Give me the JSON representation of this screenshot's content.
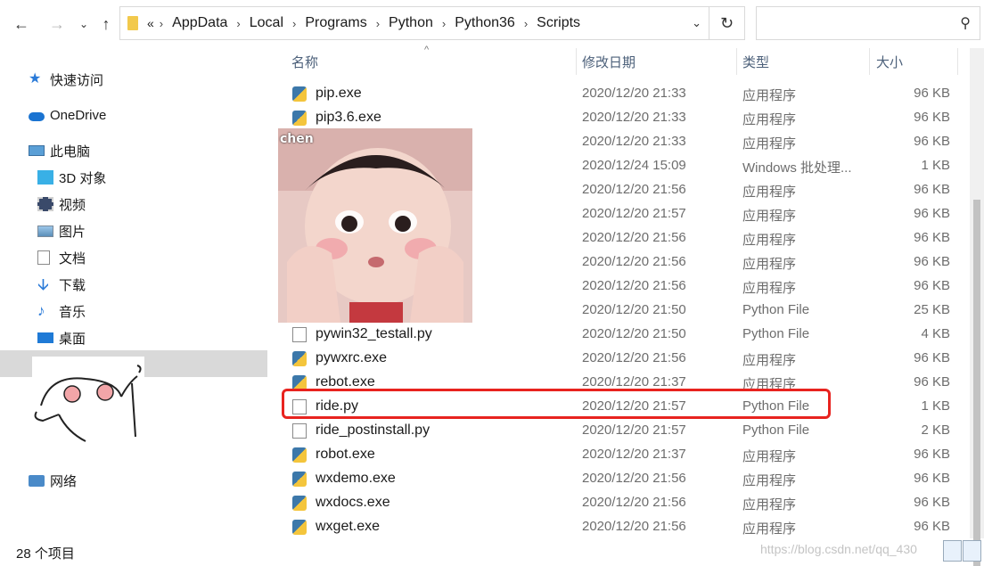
{
  "toolbar": {
    "back_icon": "arrow-left-icon",
    "forward_icon": "arrow-right-icon",
    "recent_icon": "chevron-down-icon",
    "up_icon": "arrow-up-icon",
    "overflow_glyph": "«",
    "breadcrumbs": [
      "AppData",
      "Local",
      "Programs",
      "Python",
      "Python36",
      "Scripts"
    ],
    "search_placeholder": ""
  },
  "sidebar": {
    "quick_access": "快速访问",
    "onedrive": "OneDrive",
    "this_pc": "此电脑",
    "items": [
      "3D 对象",
      "视频",
      "图片",
      "文档",
      "下载",
      "音乐",
      "桌面"
    ],
    "network": "网络"
  },
  "columns": {
    "name": "名称",
    "date": "修改日期",
    "type": "类型",
    "size": "大小"
  },
  "files": [
    {
      "name": "pip.exe",
      "date": "2020/12/20 21:33",
      "type": "应用程序",
      "size": "96 KB",
      "icon": "python-exe-icon"
    },
    {
      "name": "pip3.6.exe",
      "date": "2020/12/20 21:33",
      "type": "应用程序",
      "size": "96 KB",
      "icon": "python-exe-icon"
    },
    {
      "name": "",
      "date": "2020/12/20 21:33",
      "type": "应用程序",
      "size": "96 KB",
      "icon": ""
    },
    {
      "name": "",
      "date": "2020/12/24 15:09",
      "type": "Windows 批处理...",
      "size": "1 KB",
      "icon": ""
    },
    {
      "name": "",
      "date": "2020/12/20 21:56",
      "type": "应用程序",
      "size": "96 KB",
      "icon": ""
    },
    {
      "name": "",
      "date": "2020/12/20 21:57",
      "type": "应用程序",
      "size": "96 KB",
      "icon": ""
    },
    {
      "name": "",
      "date": "2020/12/20 21:56",
      "type": "应用程序",
      "size": "96 KB",
      "icon": ""
    },
    {
      "name": "",
      "date": "2020/12/20 21:56",
      "type": "应用程序",
      "size": "96 KB",
      "icon": ""
    },
    {
      "name": "",
      "date": "2020/12/20 21:56",
      "type": "应用程序",
      "size": "96 KB",
      "icon": ""
    },
    {
      "name": "",
      "date": "2020/12/20 21:50",
      "type": "Python File",
      "size": "25 KB",
      "icon": ""
    },
    {
      "name": "pywin32_testall.py",
      "date": "2020/12/20 21:50",
      "type": "Python File",
      "size": "4 KB",
      "icon": "document-icon"
    },
    {
      "name": "pywxrc.exe",
      "date": "2020/12/20 21:56",
      "type": "应用程序",
      "size": "96 KB",
      "icon": "python-exe-icon"
    },
    {
      "name": "rebot.exe",
      "date": "2020/12/20 21:37",
      "type": "应用程序",
      "size": "96 KB",
      "icon": "python-exe-icon"
    },
    {
      "name": "ride.py",
      "date": "2020/12/20 21:57",
      "type": "Python File",
      "size": "1 KB",
      "icon": "document-icon"
    },
    {
      "name": "ride_postinstall.py",
      "date": "2020/12/20 21:57",
      "type": "Python File",
      "size": "2 KB",
      "icon": "document-icon"
    },
    {
      "name": "robot.exe",
      "date": "2020/12/20 21:37",
      "type": "应用程序",
      "size": "96 KB",
      "icon": "python-exe-icon"
    },
    {
      "name": "wxdemo.exe",
      "date": "2020/12/20 21:56",
      "type": "应用程序",
      "size": "96 KB",
      "icon": "python-exe-icon"
    },
    {
      "name": "wxdocs.exe",
      "date": "2020/12/20 21:56",
      "type": "应用程序",
      "size": "96 KB",
      "icon": "python-exe-icon"
    },
    {
      "name": "wxget.exe",
      "date": "2020/12/20 21:56",
      "type": "应用程序",
      "size": "96 KB",
      "icon": "python-exe-icon"
    }
  ],
  "status": {
    "item_count": "28 个项目"
  },
  "overlay": {
    "photo_tag": "chen",
    "watermark": "https://blog.csdn.net/qq_430",
    "highlight_color": "#e8231f"
  }
}
